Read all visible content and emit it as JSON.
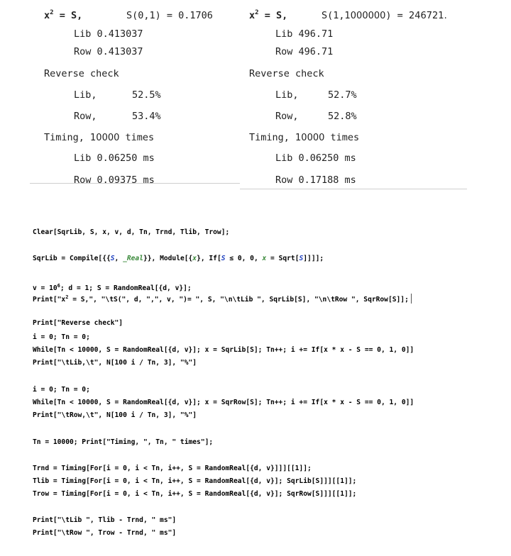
{
  "output": {
    "left": {
      "header_eq": "x",
      "header_eq_sup": "2",
      "header_eq_rest": " = S,",
      "header_s": "S(0,1) = 0.1706",
      "lib_line": "Lib 0.413037",
      "row_line": "Row 0.413037",
      "reverse_title": "Reverse check",
      "rev_lib_label": "Lib,",
      "rev_lib_value": "52.5%",
      "rev_row_label": "Row,",
      "rev_row_value": "53.4%",
      "timing_title_a": "Timing, ",
      "timing_title_n": "10000",
      "timing_title_b": " times",
      "t_lib": "Lib 0.06250 ms",
      "t_row": "Row 0.09375 ms"
    },
    "right": {
      "header_eq": "x",
      "header_eq_sup": "2",
      "header_eq_rest": " = S,",
      "header_s_a": "S(1,",
      "header_s_n": "1000000",
      "header_s_b": ") = ",
      "header_s_v": "246721.",
      "lib_line": "Lib 496.71",
      "row_line": "Row 496.71",
      "reverse_title": "Reverse check",
      "rev_lib_label": "Lib,",
      "rev_lib_value": "52.7%",
      "rev_row_label": "Row,",
      "rev_row_value": "52.8%",
      "timing_title_a": "Timing, ",
      "timing_title_n": "10000",
      "timing_title_b": " times",
      "t_lib": "Lib 0.06250 ms",
      "t_row": "Row 0.17188 ms"
    }
  },
  "code": {
    "l1": "Clear[SqrLib, S, x, v, d, Tn, Trnd, Tlib, Trow];",
    "l2a": "SqrLib = Compile[{{",
    "l2s": "S",
    "l2b": ", ",
    "l2r": "_Real",
    "l2c": "}}, Module[{",
    "l2x": "x",
    "l2d": "}, If[",
    "l2s2": "S",
    "l2e": " ≤ 0, 0, ",
    "l2x2": "x",
    "l2f": " = Sqrt[",
    "l2s3": "S",
    "l2g": "]]]];",
    "l3a": "v = 10",
    "l3sup": "6",
    "l3b": "; d = 1; S = RandomReal[{d, v}];",
    "l4a": "Print[\"x",
    "l4sup": "2",
    "l4b": " = S,\", \"\\tS(\", d, \",\", v, \")= \", S, \"\\n\\tLib \", SqrLib[S], \"\\n\\tRow \", SqrRow[S]];",
    "l5": "Print[\"Reverse check\"]",
    "l6": "i = 0; Tn = 0;",
    "l7": "While[Tn < 10000, S = RandomReal[{d, v}]; x = SqrLib[S]; Tn++; i += If[x * x - S == 0, 1, 0]]",
    "l8": "Print[\"\\tLib,\\t\", N[100 i / Tn, 3], \"%\"]",
    "l9": "i = 0; Tn = 0;",
    "l10": "While[Tn < 10000, S = RandomReal[{d, v}]; x = SqrRow[S]; Tn++; i += If[x * x - S == 0, 1, 0]]",
    "l11": "Print[\"\\tRow,\\t\", N[100 i / Tn, 3], \"%\"]",
    "l12": "Tn = 10000; Print[\"Timing, \", Tn, \" times\"];",
    "l13": "Trnd = Timing[For[i = 0, i < Tn, i++, S = RandomReal[{d, v}]]][[1]];",
    "l14": "Tlib = Timing[For[i = 0, i < Tn, i++, S = RandomReal[{d, v}]; SqrLib[S]]][[1]];",
    "l15": "Trow = Timing[For[i = 0, i < Tn, i++, S = RandomReal[{d, v}]; SqrRow[S]]][[1]];",
    "l16": "Print[\"\\tLib \", Tlib - Trnd, \" ms\"]",
    "l17": "Print[\"\\tRow \", Trow - Trnd, \" ms\"]"
  }
}
